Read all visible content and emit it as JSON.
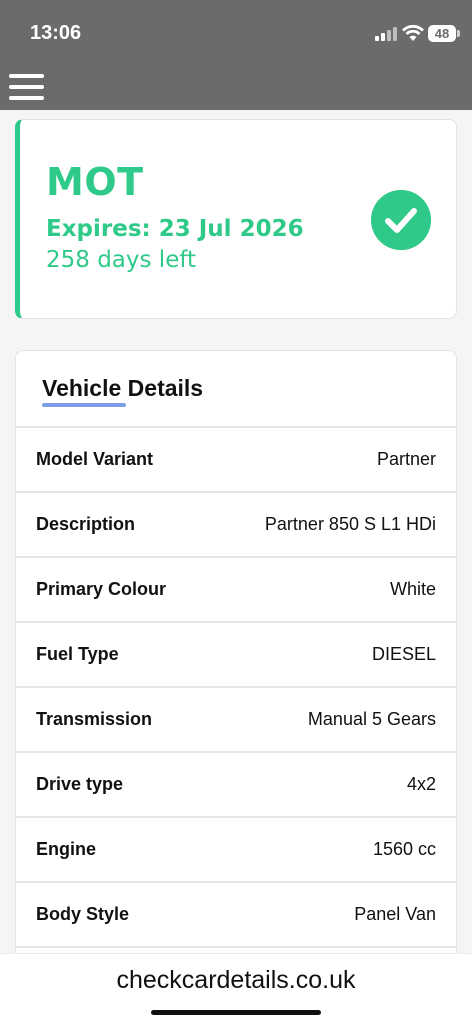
{
  "status_bar": {
    "time": "13:06",
    "battery": "48"
  },
  "mot": {
    "title": "MOT",
    "expires": "Expires: 23 Jul 2026",
    "days_left": "258 days left",
    "status_icon": "checkmark-circle-icon",
    "accent_color": "#2fc989"
  },
  "vehicle_details": {
    "heading": "Vehicle Details",
    "rows": [
      {
        "label": "Model Variant",
        "value": "Partner"
      },
      {
        "label": "Description",
        "value": "Partner 850 S L1 HDi"
      },
      {
        "label": "Primary Colour",
        "value": "White"
      },
      {
        "label": "Fuel Type",
        "value": "DIESEL"
      },
      {
        "label": "Transmission",
        "value": "Manual 5 Gears"
      },
      {
        "label": "Drive type",
        "value": "4x2"
      },
      {
        "label": "Engine",
        "value": "1560 cc"
      },
      {
        "label": "Body Style",
        "value": "Panel Van"
      }
    ]
  },
  "browser": {
    "domain": "checkcardetails.co.uk"
  }
}
